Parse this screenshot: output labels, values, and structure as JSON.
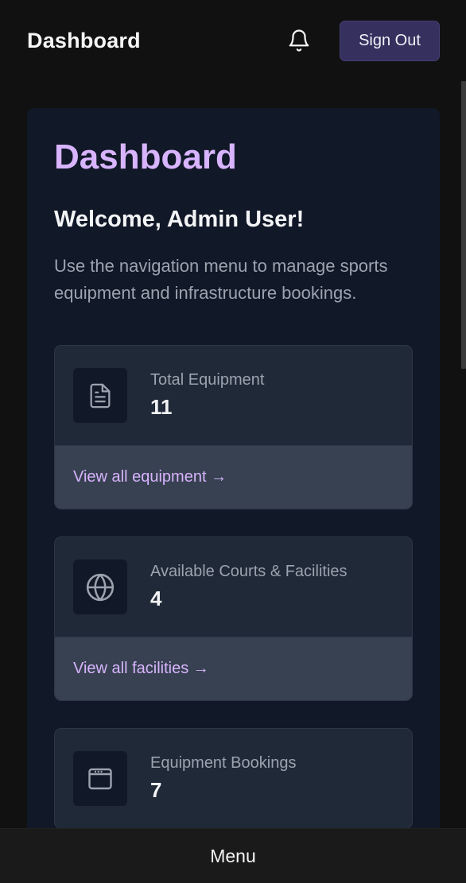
{
  "header": {
    "brand": "Dashboard",
    "notifications_icon": "bell-icon",
    "signout_label": "Sign Out"
  },
  "main": {
    "title": "Dashboard",
    "welcome": "Welcome, Admin User!",
    "intro": "Use the navigation menu to manage sports equipment and infrastructure bookings.",
    "cards": [
      {
        "icon": "document-icon",
        "label": "Total Equipment",
        "value": "11",
        "link": "View all equipment →"
      },
      {
        "icon": "globe-icon",
        "label": "Available Courts & Facilities",
        "value": "4",
        "link": "View all facilities →"
      },
      {
        "icon": "browser-window-icon",
        "label": "Equipment Bookings",
        "value": "7",
        "link": ""
      }
    ]
  },
  "footer": {
    "menu_label": "Menu"
  },
  "colors": {
    "accent": "#d8b4fe",
    "signout_bg": "#35305e",
    "card_bg": "#1f2937",
    "page_bg": "#111111"
  }
}
